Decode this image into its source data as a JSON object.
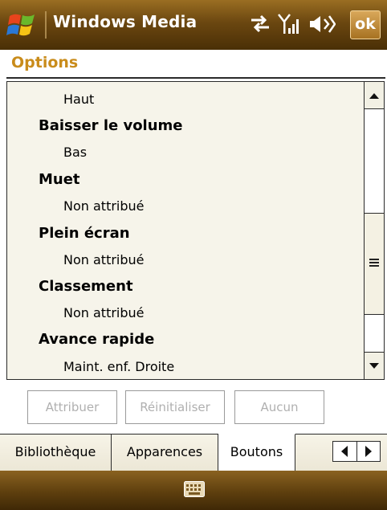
{
  "title_bar": {
    "app_title": "Windows Media",
    "ok_label": "ok",
    "icons": [
      "start-icon",
      "connectivity-icon",
      "signal-icon",
      "volume-icon"
    ]
  },
  "page": {
    "title": "Options"
  },
  "list": {
    "items": [
      {
        "text": "Haut",
        "kind": "value"
      },
      {
        "text": "Baisser le volume",
        "kind": "heading"
      },
      {
        "text": "Bas",
        "kind": "value"
      },
      {
        "text": "Muet",
        "kind": "heading"
      },
      {
        "text": "Non attribué",
        "kind": "value"
      },
      {
        "text": "Plein écran",
        "kind": "heading"
      },
      {
        "text": "Non attribué",
        "kind": "value"
      },
      {
        "text": "Classement",
        "kind": "heading"
      },
      {
        "text": "Non attribué",
        "kind": "value"
      },
      {
        "text": "Avance rapide",
        "kind": "heading"
      },
      {
        "text": "Maint. enf. Droite",
        "kind": "value"
      }
    ]
  },
  "actions": {
    "assign_label": "Attribuer",
    "reset_label": "Réinitialiser",
    "none_label": "Aucun"
  },
  "tabs": [
    {
      "label": "Bibliothèque"
    },
    {
      "label": "Apparences"
    },
    {
      "label": "Boutons"
    }
  ],
  "menubar": {
    "icon": "keyboard-icon"
  },
  "colors": {
    "title_bar": "#6b4710",
    "page_title": "#c98c1b",
    "list_background": "#f6f4ea",
    "disabled_text": "#b0b0b0"
  }
}
